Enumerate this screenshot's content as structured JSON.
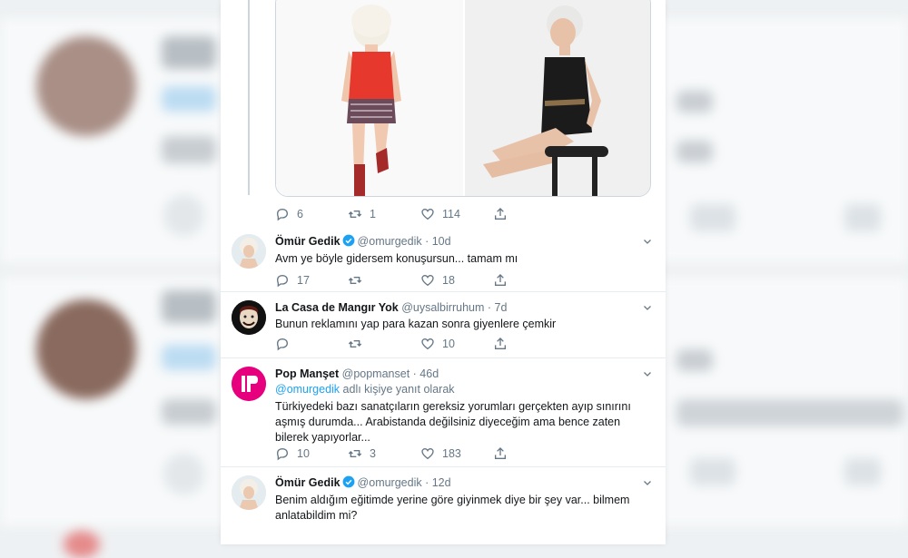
{
  "media_tweet": {
    "stats": {
      "replies": "6",
      "retweets": "1",
      "likes": "114"
    }
  },
  "tweets": [
    {
      "name": "Ömür Gedik",
      "handle": "@omurgedik",
      "time": "10d",
      "verified": true,
      "text": "Avm ye böyle gidersem konuşursun... tamam mı",
      "replies": "17",
      "retweets": "",
      "likes": "18"
    },
    {
      "name": "La Casa de Mangır Yok",
      "handle": "@uysalbirruhum",
      "time": "7d",
      "verified": false,
      "text": "Bunun reklamını yap para kazan sonra giyenlere çemkir",
      "replies": "",
      "retweets": "",
      "likes": "10"
    },
    {
      "name": "Pop Manşet",
      "handle": "@popmanset",
      "time": "46d",
      "verified": false,
      "reply_to_handle": "@omurgedik",
      "reply_to_suffix": "adlı kişiye yanıt olarak",
      "text": "Türkiyedeki bazı sanatçıların gereksiz yorumları gerçekten ayıp sınırını aşmış durumda... Arabistanda değilsiniz diyeceğim ama bence zaten bilerek yapıyorlar...",
      "replies": "10",
      "retweets": "3",
      "likes": "183"
    },
    {
      "name": "Ömür Gedik",
      "handle": "@omurgedik",
      "time": "12d",
      "verified": true,
      "text": "Benim aldığım eğitimde yerine göre giyinmek diye bir şey var... bilmem anlatabildim mi?"
    }
  ],
  "colors": {
    "accent": "#1da1f2",
    "text": "#14171a",
    "secondary": "#657786",
    "border": "#ccd6dd",
    "popmanset_brand": "#e6007e"
  },
  "icons": [
    "reply-icon",
    "retweet-icon",
    "like-icon",
    "share-icon",
    "verified-badge-icon",
    "chevron-down-icon"
  ]
}
